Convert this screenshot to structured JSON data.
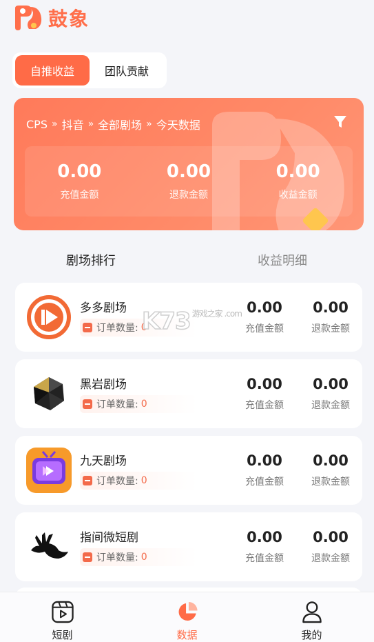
{
  "app": {
    "brand": "鼓象"
  },
  "top_tabs": [
    {
      "label": "自推收益",
      "active": true
    },
    {
      "label": "团队贡献",
      "active": false
    }
  ],
  "summary": {
    "breadcrumb": [
      "CPS",
      "抖音",
      "全部剧场",
      "今天数据"
    ],
    "separator": "»",
    "stats": [
      {
        "value": "0.00",
        "label": "充值金额"
      },
      {
        "value": "0.00",
        "label": "退款金额"
      },
      {
        "value": "0.00",
        "label": "收益金额"
      }
    ]
  },
  "section_tabs": {
    "ranking": "剧场排行",
    "detail": "收益明细"
  },
  "theaters": [
    {
      "name": "多多剧场",
      "order_label": "订单数量:",
      "order_count": "0",
      "recharge": "0.00",
      "recharge_label": "充值金额",
      "refund": "0.00",
      "refund_label": "退款金额",
      "icon": "play-circle-icon"
    },
    {
      "name": "黑岩剧场",
      "order_label": "订单数量:",
      "order_count": "0",
      "recharge": "0.00",
      "recharge_label": "充值金额",
      "refund": "0.00",
      "refund_label": "退款金额",
      "icon": "black-gem-icon"
    },
    {
      "name": "九天剧场",
      "order_label": "订单数量:",
      "order_count": "0",
      "recharge": "0.00",
      "recharge_label": "充值金额",
      "refund": "0.00",
      "refund_label": "退款金额",
      "icon": "tv-play-icon"
    },
    {
      "name": "指间微短剧",
      "order_label": "订单数量:",
      "order_count": "0",
      "recharge": "0.00",
      "recharge_label": "充值金额",
      "refund": "0.00",
      "refund_label": "退款金额",
      "icon": "bird-hand-icon"
    }
  ],
  "watermark": {
    "text": "K73",
    "sub": "游戏之家 .com"
  },
  "tabbar": [
    {
      "label": "短剧",
      "icon": "video-icon",
      "active": false
    },
    {
      "label": "数据",
      "icon": "pie-chart-icon",
      "active": true
    },
    {
      "label": "我的",
      "icon": "user-icon",
      "active": false
    }
  ],
  "colors": {
    "accent": "#ff6b47",
    "banner": "#ff8466",
    "gold": "#ffc64e"
  }
}
